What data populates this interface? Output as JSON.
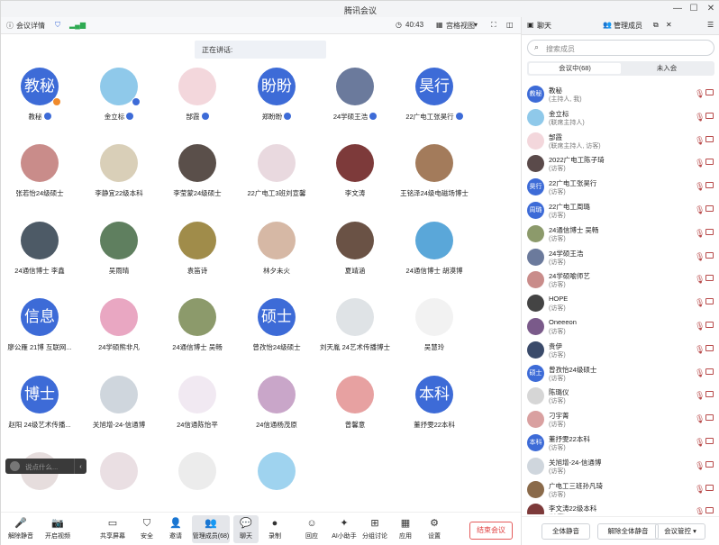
{
  "window": {
    "title": "腾讯会议",
    "controls": [
      "—",
      "☐",
      "✕"
    ]
  },
  "infobar": {
    "details_label": "会议详情",
    "timer": "40:43",
    "view_label": "宫格视图"
  },
  "main": {
    "speaking_label": "正在讲话:",
    "chat_placeholder": "说点什么...",
    "participants": [
      {
        "name": "教秘",
        "avatar_text": "教秘",
        "color": "#3d6bd7",
        "badge": "orange"
      },
      {
        "name": "金立标",
        "avatar_text": "",
        "color": "#8fc9ea",
        "badge": "blue"
      },
      {
        "name": "郜霞",
        "avatar_text": "",
        "color": "#f3d7dc",
        "badge": "none"
      },
      {
        "name": "郑盼盼",
        "avatar_text": "盼盼",
        "color": "#3d6bd7",
        "badge": "none"
      },
      {
        "name": "24学硕王浩",
        "avatar_text": "",
        "color": "#6b7a9c",
        "badge": "none"
      },
      {
        "name": "22广电工张昊行",
        "avatar_text": "昊行",
        "color": "#3d6bd7",
        "badge": "none"
      },
      {
        "name": "张若怡24级硕士",
        "avatar_text": "",
        "color": "#c98c8a",
        "badge": "none"
      },
      {
        "name": "李静宜22级本科",
        "avatar_text": "",
        "color": "#d9cfb8",
        "badge": "none"
      },
      {
        "name": "李莹蒙24级硕士",
        "avatar_text": "",
        "color": "#5a4f4a",
        "badge": "none"
      },
      {
        "name": "22广电工3班刘宣馨",
        "avatar_text": "",
        "color": "#e9d9df",
        "badge": "none"
      },
      {
        "name": "李文涛",
        "avatar_text": "",
        "color": "#7d3a3a",
        "badge": "none"
      },
      {
        "name": "王铭泽24级电磁场博士",
        "avatar_text": "",
        "color": "#a37b5b",
        "badge": "none"
      },
      {
        "name": "24通信博士 李鑫",
        "avatar_text": "",
        "color": "#4d5a66",
        "badge": "none"
      },
      {
        "name": "吴雨晴",
        "avatar_text": "",
        "color": "#5f7f5f",
        "badge": "none"
      },
      {
        "name": "袁笛诗",
        "avatar_text": "",
        "color": "#a08c4a",
        "badge": "none"
      },
      {
        "name": "林夕未火",
        "avatar_text": "",
        "color": "#d6b8a5",
        "badge": "none"
      },
      {
        "name": "夏靖涵",
        "avatar_text": "",
        "color": "#6a5245",
        "badge": "none"
      },
      {
        "name": "24通信博士 胡漠博",
        "avatar_text": "",
        "color": "#5aa7d9",
        "badge": "none"
      },
      {
        "name": "廖公雁 21博 互联网...",
        "avatar_text": "信息",
        "color": "#3d6bd7",
        "badge": "none"
      },
      {
        "name": "24学硕熊非凡",
        "avatar_text": "",
        "color": "#e9a7c2",
        "badge": "none"
      },
      {
        "name": "24通信博士 吴畅",
        "avatar_text": "",
        "color": "#8c9a6b",
        "badge": "none"
      },
      {
        "name": "曾孜怡24级硕士",
        "avatar_text": "硕士",
        "color": "#3d6bd7",
        "badge": "none"
      },
      {
        "name": "刘天胤 24艺术传播博士",
        "avatar_text": "",
        "color": "#dfe3e6",
        "badge": "none"
      },
      {
        "name": "吴慧玲",
        "avatar_text": "",
        "color": "#f2f2f2",
        "badge": "none"
      },
      {
        "name": "赵阳 24级艺术传播...",
        "avatar_text": "博士",
        "color": "#3d6bd7",
        "badge": "none"
      },
      {
        "name": "关旭增-24-信通博",
        "avatar_text": "",
        "color": "#cfd6dd",
        "badge": "none"
      },
      {
        "name": "24信通陈怡平",
        "avatar_text": "",
        "color": "#f1e9f2",
        "badge": "none"
      },
      {
        "name": "24信通杨茂原",
        "avatar_text": "",
        "color": "#c9a6c9",
        "badge": "none"
      },
      {
        "name": "曾馨意",
        "avatar_text": "",
        "color": "#e7a1a1",
        "badge": "none"
      },
      {
        "name": "董抒雯22本科",
        "avatar_text": "本科",
        "color": "#3d6bd7",
        "badge": "none"
      },
      {
        "name": "",
        "avatar_text": "",
        "color": "#e6dddd",
        "badge": "none"
      },
      {
        "name": "",
        "avatar_text": "",
        "color": "#eadfe3",
        "badge": "none"
      },
      {
        "name": "",
        "avatar_text": "",
        "color": "#ececec",
        "badge": "none"
      },
      {
        "name": "",
        "avatar_text": "",
        "color": "#9fd3ef",
        "badge": "none"
      },
      {
        "name": "",
        "avatar_text": "",
        "color": "#ffffff",
        "badge": "none"
      },
      {
        "name": "",
        "avatar_text": "",
        "color": "#ffffff",
        "badge": "none"
      }
    ]
  },
  "toolbar": {
    "items": [
      {
        "label": "解除静音",
        "icon": "🎤"
      },
      {
        "label": "开启视频",
        "icon": "📷"
      },
      {
        "label": "共享屏幕",
        "icon": "▭"
      },
      {
        "label": "安全",
        "icon": "⛉"
      },
      {
        "label": "邀请",
        "icon": "👤"
      },
      {
        "label": "管理成员(68)",
        "icon": "👥"
      },
      {
        "label": "聊天",
        "icon": "💬"
      },
      {
        "label": "录制",
        "icon": "●"
      },
      {
        "label": "回应",
        "icon": "☺"
      },
      {
        "label": "AI小助手",
        "icon": "✦"
      },
      {
        "label": "分组讨论",
        "icon": "⊞"
      },
      {
        "label": "应用",
        "icon": "▦"
      },
      {
        "label": "设置",
        "icon": "⚙"
      }
    ],
    "end_label": "结束会议"
  },
  "sidebar": {
    "tab_chat": "聊天",
    "tab_members": "管理成员",
    "search_placeholder": "搜索成员",
    "seg_in": "会议中(68)",
    "seg_out": "未入会",
    "members": [
      {
        "name": "教秘",
        "role": "(主持人, 我)",
        "avatar_text": "教秘",
        "color": "#3d6bd7"
      },
      {
        "name": "金立标",
        "role": "(联席主持人)",
        "avatar_text": "",
        "color": "#8fc9ea"
      },
      {
        "name": "郜霞",
        "role": "(联席主持人, 访客)",
        "avatar_text": "",
        "color": "#f3d7dc"
      },
      {
        "name": "2022广电工陈子琦",
        "role": "(访客)",
        "avatar_text": "",
        "color": "#5a4a4a"
      },
      {
        "name": "22广电工张昊行",
        "role": "(访客)",
        "avatar_text": "昊行",
        "color": "#3d6bd7"
      },
      {
        "name": "22广电工周璐",
        "role": "(访客)",
        "avatar_text": "周璐",
        "color": "#3d6bd7"
      },
      {
        "name": "24通信博士 吴畅",
        "role": "(访客)",
        "avatar_text": "",
        "color": "#8c9a6b"
      },
      {
        "name": "24学硕王浩",
        "role": "(访客)",
        "avatar_text": "",
        "color": "#6b7a9c"
      },
      {
        "name": "24学硕喻师艺",
        "role": "(访客)",
        "avatar_text": "",
        "color": "#c98c8a"
      },
      {
        "name": "HOPE",
        "role": "(访客)",
        "avatar_text": "",
        "color": "#444444"
      },
      {
        "name": "Oneeeon",
        "role": "(访客)",
        "avatar_text": "",
        "color": "#7a5a8a"
      },
      {
        "name": "贵伊",
        "role": "(访客)",
        "avatar_text": "",
        "color": "#3a4a6a"
      },
      {
        "name": "曾孜怡24级硕士",
        "role": "(访客)",
        "avatar_text": "硕士",
        "color": "#3d6bd7"
      },
      {
        "name": "陈璐仪",
        "role": "(访客)",
        "avatar_text": "",
        "color": "#d6d6d6"
      },
      {
        "name": "刁宇菁",
        "role": "(访客)",
        "avatar_text": "",
        "color": "#d9a0a0"
      },
      {
        "name": "董抒雯22本科",
        "role": "(访客)",
        "avatar_text": "本科",
        "color": "#3d6bd7"
      },
      {
        "name": "关旭增-24-信通博",
        "role": "(访客)",
        "avatar_text": "",
        "color": "#cfd6dd"
      },
      {
        "name": "广电工三班孙凡琦",
        "role": "(访客)",
        "avatar_text": "",
        "color": "#8a6a4a"
      },
      {
        "name": "李文涛22级本科",
        "role": "(访客)",
        "avatar_text": "",
        "color": "#7d3a3a"
      }
    ],
    "footer": {
      "mute_all": "全体静音",
      "unmute_all": "解除全体静音",
      "control": "会议管控"
    }
  },
  "colors": {
    "accent": "#3d6bd7",
    "end_red": "#e04040"
  }
}
